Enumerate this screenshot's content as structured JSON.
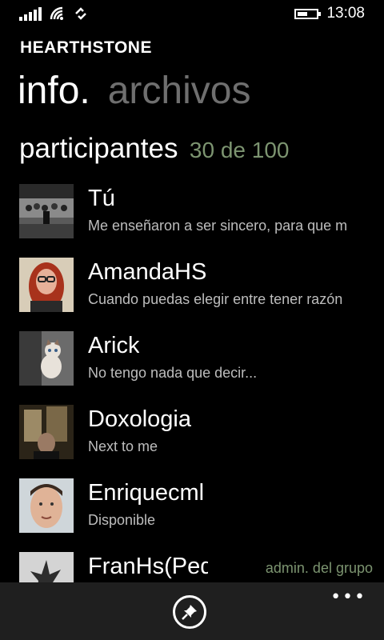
{
  "status_bar": {
    "time": "13:08",
    "signal_icon": "signal-icon",
    "wifi_icon": "wifi-icon",
    "data_icon": "data-sync-icon",
    "battery_icon": "battery-icon"
  },
  "app": {
    "title": "HEARTHSTONE"
  },
  "pivot": {
    "tabs": [
      {
        "label": "info."
      },
      {
        "label": "archivos"
      }
    ],
    "active_index": 0
  },
  "section": {
    "title": "participantes",
    "count": "30 de 100"
  },
  "participants": [
    {
      "name": "Tú",
      "status": "Me enseñaron a ser sincero, para que m"
    },
    {
      "name": "AmandaHS",
      "status": "Cuando puedas elegir entre tener razón"
    },
    {
      "name": "Arick",
      "status": "No tengo nada que decir..."
    },
    {
      "name": "Doxologia",
      "status": "Next to me"
    },
    {
      "name": "Enriquecml",
      "status": "Disponible"
    },
    {
      "name": "FranHs(Pequen",
      "status": "",
      "badge": "admin. del grupo"
    }
  ],
  "app_bar": {
    "pin_icon": "pin-icon",
    "more_icon": "more-icon"
  },
  "colors": {
    "accent": "#7c9470",
    "background": "#000000",
    "app_bar": "#1f1f1f"
  }
}
